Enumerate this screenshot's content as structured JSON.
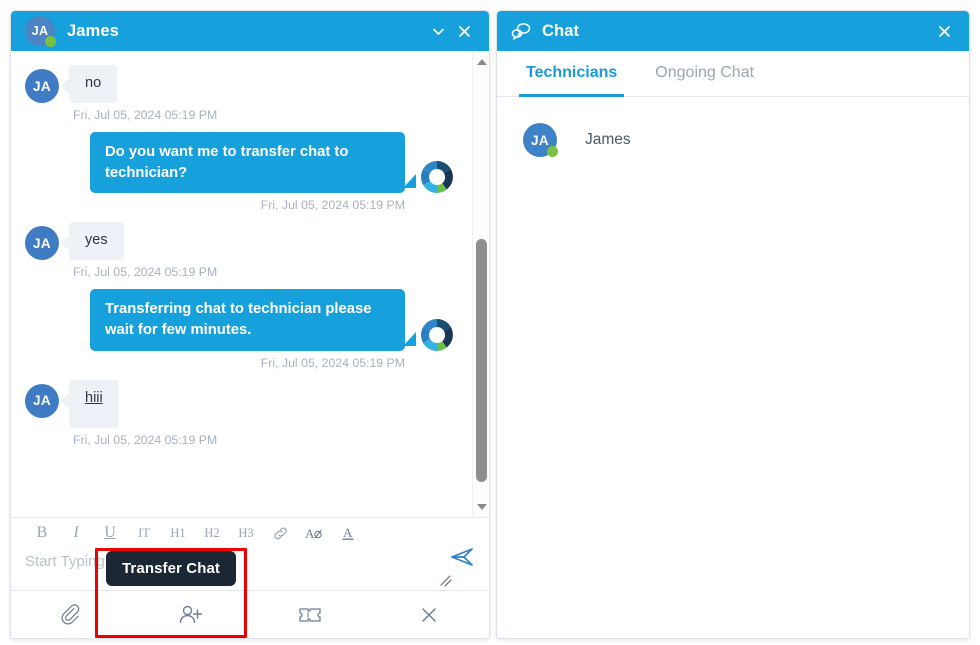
{
  "colors": {
    "brand_blue": "#16a0dc",
    "tab_active_blue": "#1b9ad6",
    "online_green": "#7ac143",
    "highlight_red": "#ee0000",
    "tooltip_bg": "#1b2733",
    "bubble_in_bg": "#eef1f6",
    "timestamp_gray": "#a8b2c0"
  },
  "chat_window": {
    "header": {
      "avatar_initials": "JA",
      "title": "James",
      "status": "online",
      "minimize_icon": "chevron-down-icon",
      "close_icon": "close-icon"
    },
    "messages": [
      {
        "direction": "in",
        "avatar_initials": "JA",
        "text": "no",
        "underlined": false,
        "tall": false,
        "time": "Fri, Jul 05, 2024 05:19 PM"
      },
      {
        "direction": "out",
        "text": "Do you want me to transfer chat to technician?",
        "time": "Fri, Jul 05, 2024 05:19 PM"
      },
      {
        "direction": "in",
        "avatar_initials": "JA",
        "text": "yes",
        "underlined": false,
        "tall": false,
        "time": "Fri, Jul 05, 2024 05:19 PM"
      },
      {
        "direction": "out",
        "text": "Transferring chat to technician please wait for few minutes.",
        "time": "Fri, Jul 05, 2024 05:19 PM"
      },
      {
        "direction": "in",
        "avatar_initials": "JA",
        "text": "hiii",
        "underlined": true,
        "tall": true,
        "time": "Fri, Jul 05, 2024 05:19 PM"
      }
    ],
    "scrollbar": {
      "up_arrow_icon": "scroll-up-arrow-icon",
      "down_arrow_icon": "scroll-down-arrow-icon",
      "thumb_top_pct": 44,
      "thumb_height_pct": 57
    },
    "format_toolbar": [
      {
        "name": "bold-button",
        "label": "B",
        "style": "bold"
      },
      {
        "name": "italic-button",
        "label": "I",
        "style": "ital"
      },
      {
        "name": "underline-button",
        "label": "U",
        "style": "undl"
      },
      {
        "name": "strikethrough-button",
        "label": "IT",
        "style": "small"
      },
      {
        "name": "heading-1-button",
        "label": "H1",
        "style": "small"
      },
      {
        "name": "heading-2-button",
        "label": "H2",
        "style": "small"
      },
      {
        "name": "heading-3-button",
        "label": "H3",
        "style": "small"
      }
    ],
    "composer": {
      "placeholder": "Start Typing...",
      "value": "",
      "link_icon": "link-icon",
      "clear_format_icon": "clear-formatting-icon",
      "text_color_icon": "text-color-icon",
      "send_icon": "send-icon",
      "resize_icon": "resize-handle-icon"
    },
    "action_bar": [
      {
        "name": "attach-file-button",
        "icon": "paperclip-icon"
      },
      {
        "name": "transfer-chat-button",
        "icon": "add-user-icon"
      },
      {
        "name": "create-ticket-button",
        "icon": "ticket-icon"
      },
      {
        "name": "end-chat-button",
        "icon": "close-icon"
      }
    ],
    "tooltip": {
      "text": "Transfer Chat",
      "target": "transfer-chat-button"
    }
  },
  "chat_panel": {
    "header": {
      "icon": "chat-bubbles-icon",
      "title": "Chat",
      "close_icon": "close-icon"
    },
    "tabs": [
      {
        "label": "Technicians",
        "active": true
      },
      {
        "label": "Ongoing Chat",
        "active": false
      }
    ],
    "technicians": [
      {
        "initials": "JA",
        "name": "James",
        "status": "online"
      }
    ]
  }
}
